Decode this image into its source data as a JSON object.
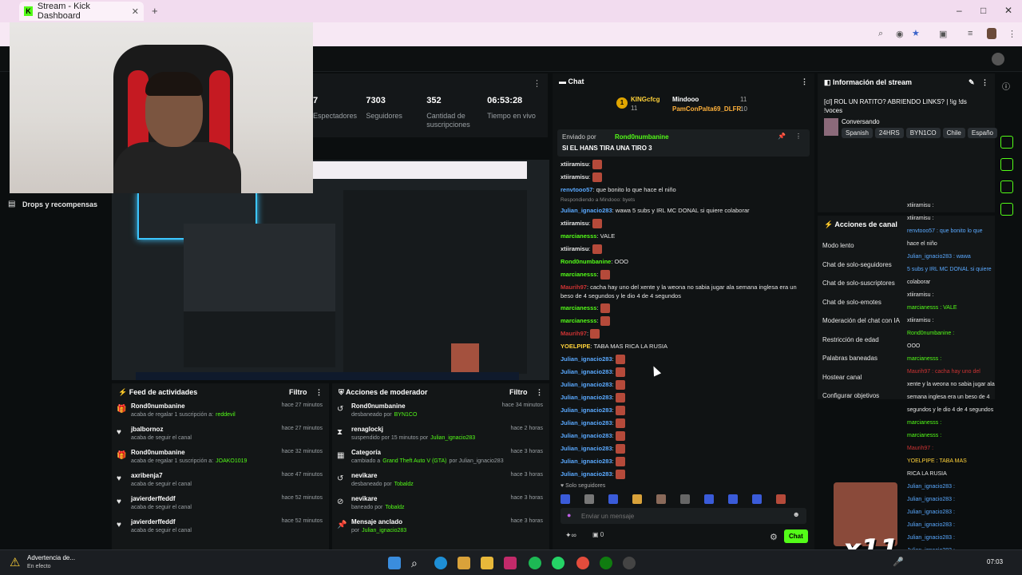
{
  "browser": {
    "tab_title": "Stream - Kick Dashboard",
    "new_tab": "+",
    "win_min": "–",
    "win_max": "□",
    "win_close": "✕"
  },
  "nav": {
    "drops": "Drops y recompensas"
  },
  "stats": [
    {
      "value": "7",
      "label": "Espectadores"
    },
    {
      "value": "7303",
      "label": "Seguidores"
    },
    {
      "value": "352",
      "label": "Cantidad de suscripciones"
    },
    {
      "value": "06:53:28",
      "label": "Tiempo en vivo"
    }
  ],
  "activity": {
    "title": "Feed de actividades",
    "filter": "Filtro",
    "items": [
      {
        "name": "Rond0numbanine",
        "desc": "acaba de regalar 1 suscripción a:",
        "target": "reddevil",
        "time": "hace 27 minutos",
        "icon": "gift"
      },
      {
        "name": "jbalbornoz",
        "desc": "acaba de seguir el canal",
        "target": "",
        "time": "hace 27 minutos",
        "icon": "heart"
      },
      {
        "name": "Rond0numbanine",
        "desc": "acaba de regalar 1 suscripción a:",
        "target": "JOAKO1019",
        "time": "hace 32 minutos",
        "icon": "gift"
      },
      {
        "name": "axribenja7",
        "desc": "acaba de seguir el canal",
        "target": "",
        "time": "hace 47 minutos",
        "icon": "heart"
      },
      {
        "name": "javierderffeddf",
        "desc": "acaba de seguir el canal",
        "target": "",
        "time": "hace 52 minutos",
        "icon": "heart"
      },
      {
        "name": "javierderffeddf",
        "desc": "acaba de seguir el canal",
        "target": "",
        "time": "hace 52 minutos",
        "icon": "heart"
      }
    ]
  },
  "modactions": {
    "title": "Acciones de moderador",
    "filter": "Filtro",
    "items": [
      {
        "name": "Rond0numbanine",
        "desc": "desbaneado por",
        "by": "BYN1CO",
        "extra": "",
        "time": "hace 34 minutos",
        "icon": "undo"
      },
      {
        "name": "renaglockj",
        "desc": "suspendido por 15 minutos por",
        "by": "Julian_ignacio283",
        "extra": "",
        "time": "hace 2 horas",
        "icon": "hourglass"
      },
      {
        "name": "Categoría",
        "desc": "cambiado a",
        "by": "Grand Theft Auto V (GTA)",
        "extra": "por Julian_ignacio283",
        "time": "hace 3 horas",
        "icon": "category"
      },
      {
        "name": "nevikare",
        "desc": "desbaneado por",
        "by": "Tobaldz",
        "extra": "",
        "time": "hace 3 horas",
        "icon": "undo"
      },
      {
        "name": "nevikare",
        "desc": "baneado por",
        "by": "Tobaldz",
        "extra": "",
        "time": "hace 3 horas",
        "icon": "ban"
      },
      {
        "name": "Mensaje anclado",
        "desc": "por",
        "by": "Julian_ignacio283",
        "extra": "",
        "time": "hace 3 horas",
        "icon": "pin"
      }
    ]
  },
  "chat": {
    "title": "Chat",
    "leaders": {
      "rank1": "KINGcfcg",
      "rank1_count": "11",
      "rank2": "Mindooo",
      "rank2_count": "11",
      "rank3": "PamConPalta69_DLFR",
      "rank3_count": "10"
    },
    "pinned_by_label": "Enviado por",
    "pinned_user": "Rond0numbanine",
    "pinned_text": "SI EL HANS TIRA UNA TIRO 3",
    "messages": [
      {
        "user": "xtiiramisu",
        "color": "#e6e6e6",
        "text": ""
      },
      {
        "user": "xtiiramisu",
        "color": "#e6e6e6",
        "text": ""
      },
      {
        "user": "renvtooo57",
        "color": "#5aa9ff",
        "text": "que bonito lo que hace el niño"
      },
      {
        "user": "Julian_ignacio283",
        "color": "#5aa9ff",
        "text": "wawa 5 subs y IRL MC DONAL si quiere colaborar",
        "reply": "Respondiendo a Mindooo: byets"
      },
      {
        "user": "xtiiramisu",
        "color": "#e6e6e6",
        "text": ""
      },
      {
        "user": "marcianesss",
        "color": "#53fc18",
        "text": "VALE"
      },
      {
        "user": "xtiiramisu",
        "color": "#e6e6e6",
        "text": ""
      },
      {
        "user": "Rond0numbanine",
        "color": "#53fc18",
        "text": "OOO"
      },
      {
        "user": "marcianesss",
        "color": "#53fc18",
        "text": ""
      },
      {
        "user": "Maurih97",
        "color": "#c33",
        "text": "cacha hay uno del xente y la weona no sabia jugar ala semana inglesa era un beso de 4 segundos y le dio 4 de 4 segundos"
      },
      {
        "user": "marcianesss",
        "color": "#53fc18",
        "text": ""
      },
      {
        "user": "marcianesss",
        "color": "#53fc18",
        "text": ""
      },
      {
        "user": "Maurih97",
        "color": "#c33",
        "text": ""
      },
      {
        "user": "YOELPIPE",
        "color": "#ffd23a",
        "text": "TABA MAS RICA LA RUSIA"
      },
      {
        "user": "Julian_ignacio283",
        "color": "#5aa9ff",
        "text": ""
      },
      {
        "user": "Julian_ignacio283",
        "color": "#5aa9ff",
        "text": ""
      },
      {
        "user": "Julian_ignacio283",
        "color": "#5aa9ff",
        "text": ""
      },
      {
        "user": "Julian_ignacio283",
        "color": "#5aa9ff",
        "text": ""
      },
      {
        "user": "Julian_ignacio283",
        "color": "#5aa9ff",
        "text": ""
      },
      {
        "user": "Julian_ignacio283",
        "color": "#5aa9ff",
        "text": ""
      },
      {
        "user": "Julian_ignacio283",
        "color": "#5aa9ff",
        "text": ""
      },
      {
        "user": "Julian_ignacio283",
        "color": "#5aa9ff",
        "text": ""
      },
      {
        "user": "Julian_ignacio283",
        "color": "#5aa9ff",
        "text": ""
      },
      {
        "user": "Julian_ignacio283",
        "color": "#5aa9ff",
        "text": ""
      }
    ],
    "followers_only": "Solo seguidores",
    "input_placeholder": "Enviar un mensaje",
    "send_button": "Chat",
    "counter": "0"
  },
  "info": {
    "title": "Información del stream",
    "stream_title": "[cl] ROL UN RATITO? ABRIENDO LINKS? | !ig !ds !voces",
    "category": "Conversando",
    "tags": [
      "Spanish",
      "24HRS",
      "BYN1CO",
      "Chile",
      "Españo"
    ]
  },
  "actions": {
    "title": "Acciones de canal",
    "items": [
      "Modo lento",
      "Chat de solo-seguidores",
      "Chat de solo-suscriptores",
      "Chat de solo-emotes",
      "Moderación del chat con IA",
      "Restricción de edad",
      "Palabras baneadas",
      "Hostear canal",
      "Configurar objetivos"
    ]
  },
  "rightchat": [
    {
      "t": "xtiiramisu :",
      "c": "#e6e6e6"
    },
    {
      "t": "xtiiramisu :",
      "c": "#e6e6e6"
    },
    {
      "t": "renvtooo57 : que bonito lo que",
      "c": "#5aa9ff"
    },
    {
      "t": "hace el niño",
      "c": "#e6e6e6"
    },
    {
      "t": "Julian_ignacio283 : wawa",
      "c": "#5aa9ff"
    },
    {
      "t": "5 subs y IRL MC DONAL si quiere",
      "c": "#5aa9ff"
    },
    {
      "t": "colaborar",
      "c": "#e6e6e6"
    },
    {
      "t": "xtiiramisu :",
      "c": "#e6e6e6"
    },
    {
      "t": "marcianesss : VALE",
      "c": "#53fc18"
    },
    {
      "t": "xtiiramisu :",
      "c": "#e6e6e6"
    },
    {
      "t": "Rond0numbanine :",
      "c": "#53fc18"
    },
    {
      "t": "OOO",
      "c": "#e6e6e6"
    },
    {
      "t": "marcianesss :",
      "c": "#53fc18"
    },
    {
      "t": "Maurih97 : cacha hay uno del",
      "c": "#c33"
    },
    {
      "t": "xente y la weona no sabia jugar ala",
      "c": "#e6e6e6"
    },
    {
      "t": "semana inglesa era un beso de 4",
      "c": "#e6e6e6"
    },
    {
      "t": "segundos y le dio 4 de 4 segundos",
      "c": "#e6e6e6"
    },
    {
      "t": "marcianesss :",
      "c": "#53fc18"
    },
    {
      "t": "marcianesss :",
      "c": "#53fc18"
    },
    {
      "t": "Maurih97 :",
      "c": "#c33"
    },
    {
      "t": "YOELPIPE : TABA MAS",
      "c": "#ffd23a"
    },
    {
      "t": "RICA LA RUSIA",
      "c": "#e6e6e6"
    },
    {
      "t": "Julian_ignacio283 :",
      "c": "#5aa9ff"
    },
    {
      "t": "Julian_ignacio283 :",
      "c": "#5aa9ff"
    },
    {
      "t": "Julian_ignacio283 :",
      "c": "#5aa9ff"
    },
    {
      "t": "Julian_ignacio283 :",
      "c": "#5aa9ff"
    },
    {
      "t": "Julian_ignacio283 :",
      "c": "#5aa9ff"
    },
    {
      "t": "Julian_ignacio283 :",
      "c": "#5aa9ff"
    },
    {
      "t": "Julian_ignacio283 :",
      "c": "#5aa9ff"
    },
    {
      "t": "Julian_ignacio283 :",
      "c": "#5aa9ff"
    }
  ],
  "overlay": {
    "x11": "x11"
  },
  "taskbar": {
    "warning_title": "Advertencia de...",
    "warning_sub": "En efecto",
    "clock": "07:03"
  },
  "colors": {
    "accent": "#53fc18",
    "bg": "#0b0e0f",
    "panel": "#131617"
  }
}
